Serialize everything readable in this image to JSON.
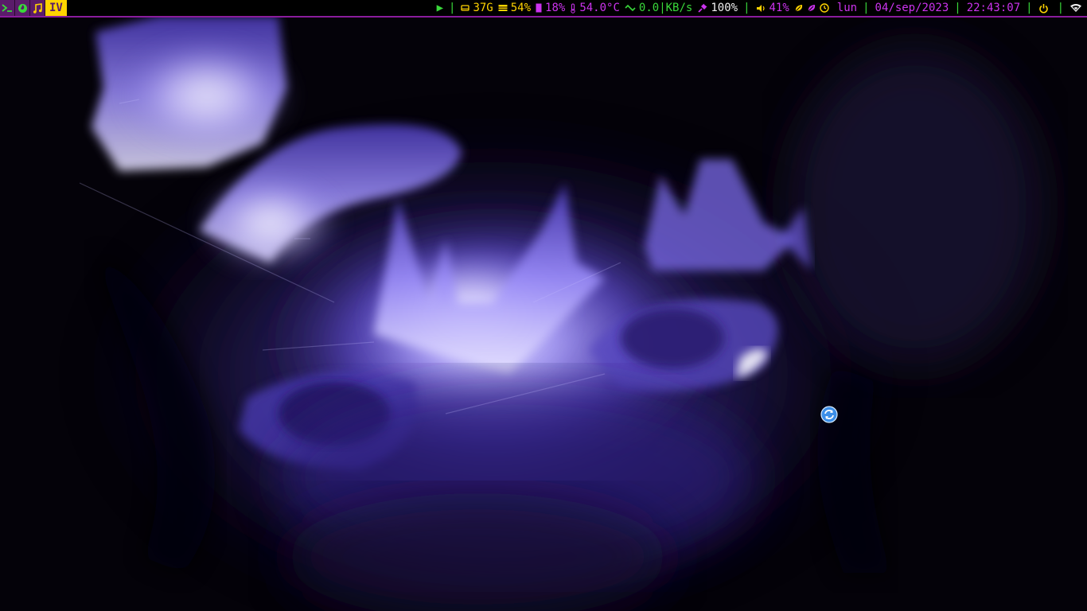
{
  "workspaces": {
    "icons": [
      "terminal-icon",
      "browser-icon",
      "music-icon"
    ],
    "active_label": "IV"
  },
  "status": {
    "play_symbol": "▶",
    "disk": "37G",
    "memory": "54%",
    "cpu": "18%",
    "temperature": "54.0°C",
    "network": "0.0|KB/s",
    "battery": "100%",
    "volume": "41%",
    "day": "lun",
    "date": "04/sep/2023",
    "time": "22:43:07"
  },
  "colors": {
    "accent": "#cc33ee",
    "highlight": "#ffd400",
    "separator": "#39d83a",
    "workspace_bg": "#5a1c6a"
  },
  "desktop": {
    "wallpaper": "abstract-purple-face-artwork",
    "floating_icon": "refresh-icon"
  }
}
